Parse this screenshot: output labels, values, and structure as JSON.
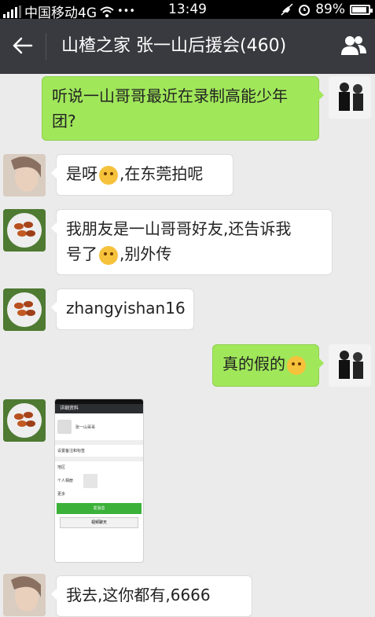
{
  "status_bar": {
    "carrier": "中国移动4G",
    "dots": "•••",
    "time": "13:49",
    "battery_pct": "89%",
    "battery_fill": 0.89
  },
  "nav": {
    "title": "山楂之家 张一山后援会(460)"
  },
  "messages": [
    {
      "side": "out",
      "text_a": "听说一山哥哥最近在录制高能少年",
      "text_b": "团?"
    },
    {
      "side": "in",
      "text_a": "是呀",
      "emoji": "smirk-emoji",
      "text_b": ",在东莞拍呢"
    },
    {
      "side": "in",
      "text_a": "我朋友是一山哥哥好友,还告诉我",
      "text_b": "号了",
      "emoji": "shush-emoji",
      "text_c": ",别外传"
    },
    {
      "side": "in",
      "text_a": "zhangyishan16"
    },
    {
      "side": "out",
      "text_a": "真的假的",
      "emoji": "surprised-emoji"
    },
    {
      "side": "in",
      "image": "profile-screenshot"
    },
    {
      "side": "in",
      "text_a": "我去,这你都有,6666"
    }
  ],
  "screenshot_thumb": {
    "header": "详细资料",
    "name": "张一山哥哥",
    "row1": "设置备注和标签",
    "row2": "地区",
    "row3": "个人相册",
    "row4": "更多",
    "green_btn": "发消息",
    "gray_btn": "视频聊天"
  }
}
